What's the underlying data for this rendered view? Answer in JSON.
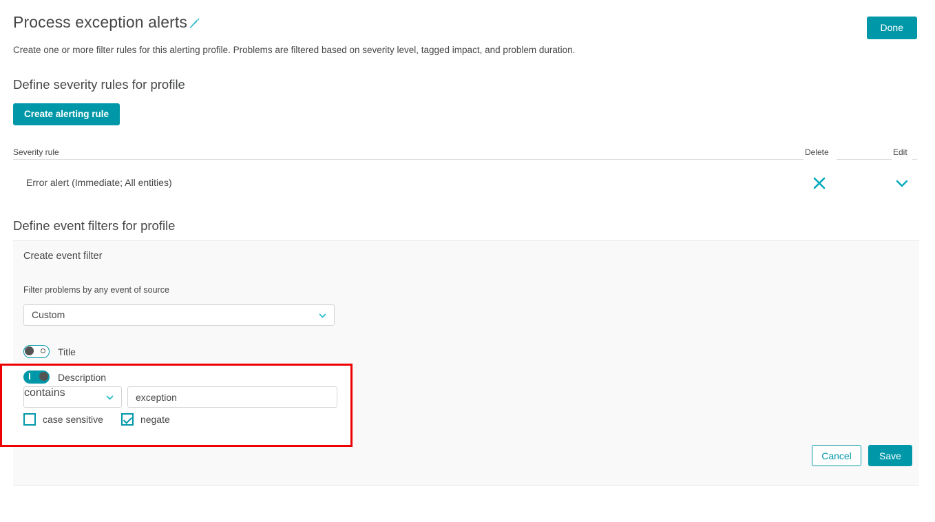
{
  "header": {
    "title": "Process exception alerts",
    "edit_icon": "pencil-icon",
    "subtitle": "Create one or more filter rules for this alerting profile. Problems are filtered based on severity level, tagged impact, and problem duration.",
    "done_label": "Done"
  },
  "severity_section": {
    "heading": "Define severity rules for profile",
    "create_rule_label": "Create alerting rule",
    "columns": [
      "Severity rule",
      "Delete",
      "Edit"
    ],
    "rows": [
      {
        "name": "Error alert (Immediate; All entities)",
        "delete_icon": "close-x-icon",
        "edit_icon": "chevron-down-icon"
      }
    ]
  },
  "event_section": {
    "heading": "Define event filters for profile",
    "panel_title": "Create event filter",
    "source_label": "Filter problems by any event of source",
    "source_value": "Custom",
    "source_options": [
      "Custom"
    ],
    "conditions": [
      {
        "id": "title",
        "label": "Title",
        "enabled": false
      },
      {
        "id": "description",
        "label": "Description",
        "enabled": true,
        "operator": "contains",
        "operator_options": [
          "contains"
        ],
        "value": "exception",
        "value_placeholder": "",
        "checkboxes": [
          {
            "label": "case sensitive",
            "checked": false
          },
          {
            "label": "negate",
            "checked": true
          }
        ]
      }
    ],
    "cancel_label": "Cancel",
    "save_label": "Save"
  },
  "colors": {
    "accent": "#0098a8",
    "highlight": "#ee0000",
    "text": "#454646",
    "panel_bg": "#f9f9f9"
  }
}
